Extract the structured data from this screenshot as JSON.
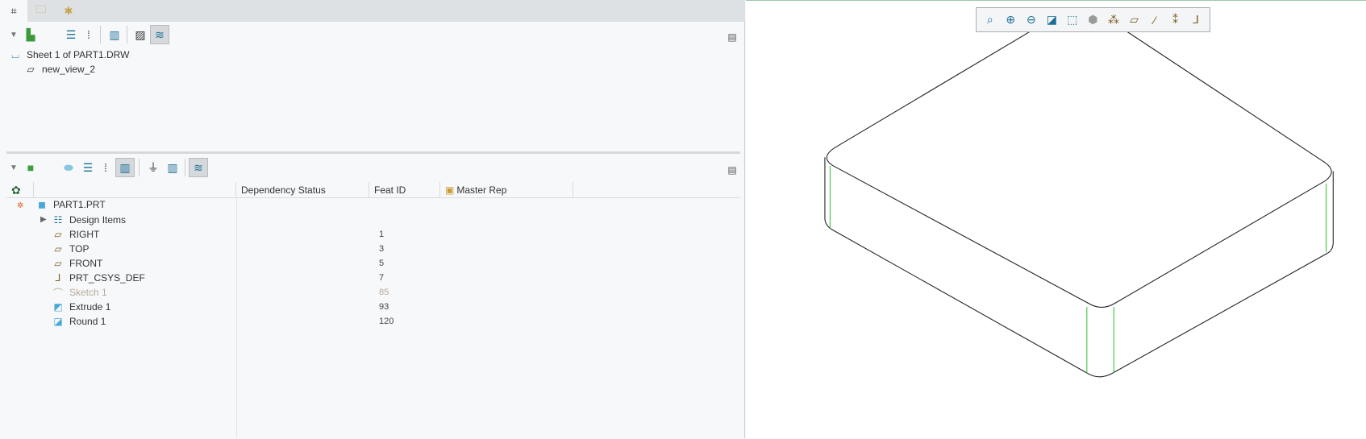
{
  "tabs": [
    {
      "icon": "model-tree-icon"
    },
    {
      "icon": "folder-browser-icon"
    },
    {
      "icon": "favorites-folder-icon"
    }
  ],
  "drawing_tree": {
    "root": "Sheet 1 of PART1.DRW",
    "children": [
      "new_view_2"
    ]
  },
  "model_tree": {
    "columns": [
      "Dependency Status",
      "Feat ID",
      "Master Rep"
    ],
    "rows": [
      {
        "name": "PART1.PRT",
        "id": "",
        "icon": "part-icon"
      },
      {
        "name": "Design Items",
        "id": "",
        "icon": "design-items-icon",
        "expandable": true
      },
      {
        "name": "RIGHT",
        "id": "1",
        "icon": "datum-plane-icon"
      },
      {
        "name": "TOP",
        "id": "3",
        "icon": "datum-plane-icon"
      },
      {
        "name": "FRONT",
        "id": "5",
        "icon": "datum-plane-icon"
      },
      {
        "name": "PRT_CSYS_DEF",
        "id": "7",
        "icon": "csys-icon"
      },
      {
        "name": "Sketch 1",
        "id": "85",
        "icon": "sketch-icon",
        "suppressed": true
      },
      {
        "name": "Extrude 1",
        "id": "93",
        "icon": "extrude-icon"
      },
      {
        "name": "Round 1",
        "id": "120",
        "icon": "round-icon"
      }
    ]
  },
  "colors": {
    "accent": "#1c6e96",
    "datum": "#7a5b1e",
    "edge_green": "#3cc43c",
    "dimmed": "#b5ab9a"
  }
}
